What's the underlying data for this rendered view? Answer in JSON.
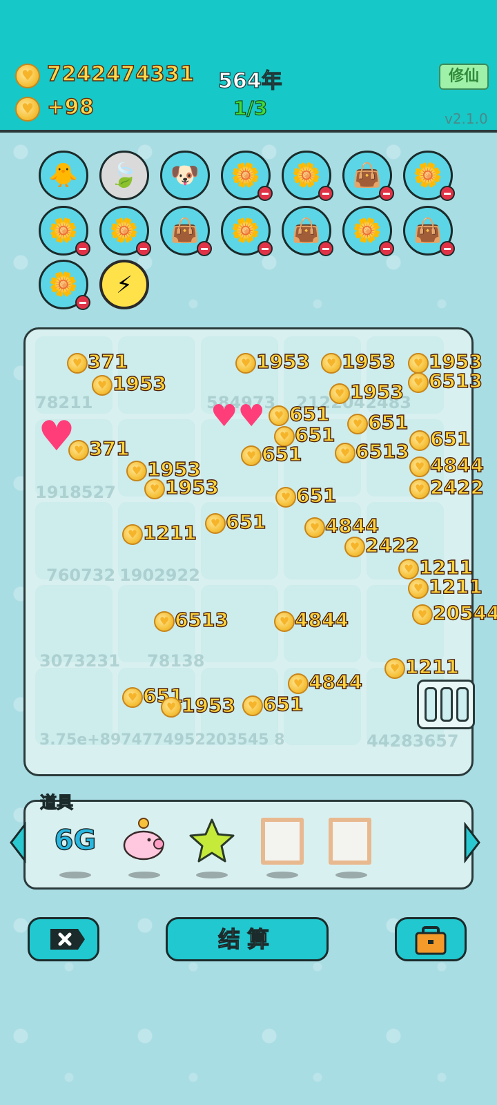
{
  "header": {
    "total_coins": "7242474331",
    "coin_rate": "+98",
    "year": "564年",
    "progress": "1/3",
    "mode_button": "修仙",
    "version": "v2.1.0"
  },
  "slots": [
    {
      "icon": "chick-egg-icon",
      "glyph": "🐥",
      "removable": false
    },
    {
      "icon": "leaf-icon",
      "glyph": "🍃",
      "removable": false
    },
    {
      "icon": "dog-icon",
      "glyph": "🐶",
      "removable": false
    },
    {
      "icon": "flower-pot-icon",
      "glyph": "🌼",
      "removable": true
    },
    {
      "icon": "flower-pot-icon",
      "glyph": "🌼",
      "removable": true
    },
    {
      "icon": "seed-bag-icon",
      "glyph": "👜",
      "removable": true
    },
    {
      "icon": "flower-pot-icon",
      "glyph": "🌼",
      "removable": true
    },
    {
      "icon": "flower-pot-icon",
      "glyph": "🌼",
      "removable": true
    },
    {
      "icon": "flower-pot-icon",
      "glyph": "🌼",
      "removable": true
    },
    {
      "icon": "seed-bag-icon",
      "glyph": "👜",
      "removable": true
    },
    {
      "icon": "flower-pot-icon",
      "glyph": "🌼",
      "removable": true
    },
    {
      "icon": "seed-bag-icon",
      "glyph": "👜",
      "removable": true
    },
    {
      "icon": "flower-pot-icon",
      "glyph": "🌼",
      "removable": true
    },
    {
      "icon": "seed-bag-icon",
      "glyph": "👜",
      "removable": true
    },
    {
      "icon": "flower-pot-icon",
      "glyph": "🌼",
      "removable": true
    },
    {
      "icon": "lightning-icon",
      "glyph": "⚡",
      "removable": false
    }
  ],
  "board": {
    "cell_values": [
      "78211",
      "584973",
      "2122042483",
      "1918527",
      "760732",
      "1902922",
      "3073231",
      "78138",
      "3.75e+8974774952203545 8",
      "44283657"
    ],
    "floating_numbers": [
      "371",
      "1953",
      "1953",
      "1953",
      "1953",
      "1953",
      "6513",
      "651",
      "651",
      "651",
      "651",
      "371",
      "1953",
      "651",
      "1953",
      "6513",
      "651",
      "4844",
      "2422",
      "651",
      "4844",
      "2422",
      "1211",
      "1211",
      "20544",
      "1211",
      "6513",
      "4844",
      "4844",
      "651",
      "1953",
      "651",
      "1211"
    ]
  },
  "items": {
    "title": "道具",
    "list": [
      {
        "icon": "6g-icon",
        "label": "6G"
      },
      {
        "icon": "piggy-bank-icon",
        "label": ""
      },
      {
        "icon": "star-icon",
        "label": ""
      },
      {
        "icon": "empty-frame-icon",
        "label": ""
      },
      {
        "icon": "empty-frame-icon",
        "label": ""
      }
    ]
  },
  "buttons": {
    "settle": "结算"
  },
  "colors": {
    "header_bg": "#17c8c8",
    "board_bg": "#d9f0f0",
    "coin_text": "#ffd84a",
    "button_bg": "#21c8d0"
  }
}
